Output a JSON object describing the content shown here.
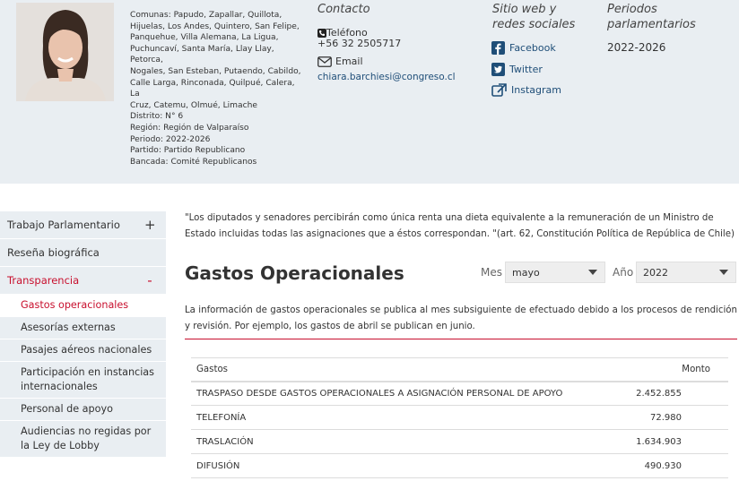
{
  "profile": {
    "photo_alt": "Foto diputada",
    "info_lines": [
      "Comunas: Papudo, Zapallar, Quillota,",
      "Hijuelas, Los Andes, Quintero, San Felipe,",
      "Panquehue, Villa Alemana, La Ligua,",
      "Puchuncaví, Santa María, Llay Llay, Petorca,",
      "Nogales, San Esteban, Putaendo, Cabildo,",
      "Calle Larga, Rinconada, Quilpué, Calera, La",
      "Cruz, Catemu, Olmué, Limache",
      "Distrito: N° 6",
      "Región: Región de Valparaíso",
      "Periodo: 2022-2026",
      "Partido: Partido Republicano",
      "Bancada: Comité Republicanos"
    ]
  },
  "contact": {
    "title": "Contacto",
    "phone_label": "Teléfono",
    "phone": "+56 32 2505717",
    "email_label": "Email",
    "email": "chiara.barchiesi@congreso.cl"
  },
  "web": {
    "title": "Sitio web y redes sociales",
    "links": [
      "Facebook",
      "Twitter",
      "Instagram"
    ]
  },
  "periods": {
    "title": "Periodos parlamentarios",
    "values": [
      "2022-2026"
    ]
  },
  "sidebar": {
    "top_items": [
      "Trabajo Parlamentario",
      "Reseña biográfica",
      "Transparencia"
    ],
    "sub_items": [
      "Gastos operacionales",
      "Asesorías externas",
      "Pasajes aéreos nacionales",
      "Participación en instancias internacionales",
      "Personal de apoyo",
      "Audiencias no regidas por la Ley de Lobby"
    ]
  },
  "main": {
    "quote": "\"Los diputados y senadores percibirán como única renta una dieta equivalente a la remuneración de un Ministro de Estado incluidas todas las asignaciones que a éstos correspondan. \"(art. 62, Constitución Política de República de Chile)",
    "title": "Gastos Operacionales",
    "mes_label": "Mes",
    "mes_value": "mayo",
    "anio_label": "Año",
    "anio_value": "2022",
    "note": "La información de gastos operacionales se publica al mes subsiguiente de efectuado debido a los procesos de rendición y revisión. Por ejemplo, los gastos de abril se publican en junio.",
    "table": {
      "headers": [
        "Gastos",
        "Monto"
      ],
      "rows": [
        [
          "TRASPASO DESDE GASTOS OPERACIONALES A ASIGNACIÓN PERSONAL DE APOYO",
          "2.452.855"
        ],
        [
          "TELEFONÍA",
          "72.980"
        ],
        [
          "TRASLACIÓN",
          "1.634.903"
        ],
        [
          "DIFUSIÓN",
          "490.930"
        ]
      ]
    }
  },
  "colors": {
    "accent": "#c8102e",
    "band": "#e9eef2",
    "link": "#1f4e78"
  }
}
